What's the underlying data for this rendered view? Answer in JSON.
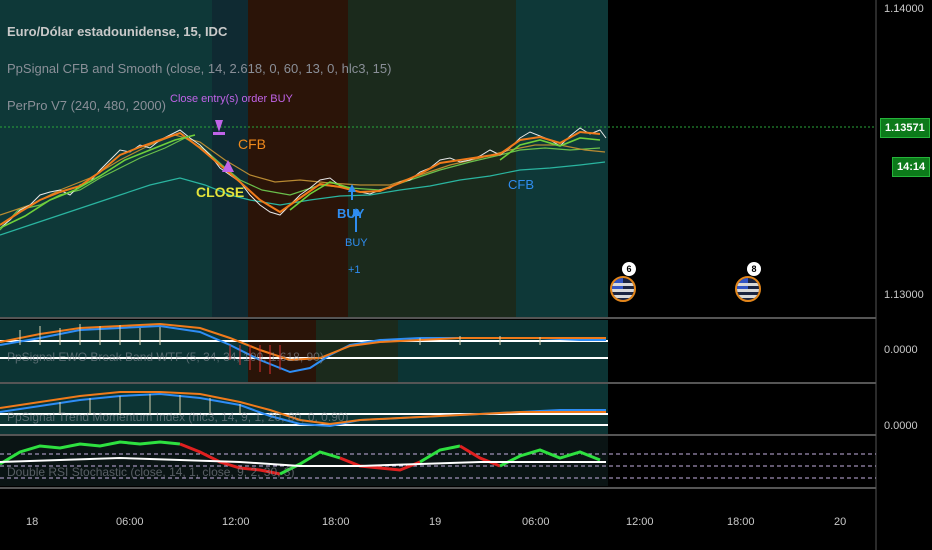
{
  "title": {
    "symbol": "Euro/Dólar estadounidense, 15, IDC",
    "indicator_1": "PpSignal CFB and Smooth (close, 14, 2.618, 0, 60, 13, 0, hlc3, 15)",
    "indicator_2": "PerPro V7 (240, 480, 2000)"
  },
  "pane_labels": {
    "ewo": "PpSignal EWO Break Band WTF (5, 34, 34, 100, 1.618, 90)",
    "second": "PpSignal Trend Momentum Index (hlc3, 14, 9, 1, 20, 80, 0, 0.90)",
    "rsi": "Double RSI Stochastic (close, 14, 1, close, 9, 2, 30, 3)"
  },
  "annotations": {
    "close_entry": "Close entry(s) order BUY",
    "cfb_1": "CFB",
    "close": "CLOSE",
    "buy_1": "BUY",
    "buy_2": "BUY",
    "buy_plus": "+1",
    "cfb_2": "CFB"
  },
  "price_axis": {
    "top": "1.14000",
    "current": "1.13571",
    "countdown": "14:14",
    "bottom": "1.13000",
    "osc_1": "0.0000",
    "osc_2": "0.0000"
  },
  "time_axis": [
    "18",
    "06:00",
    "12:00",
    "18:00",
    "19",
    "06:00",
    "12:00",
    "18:00",
    "20"
  ],
  "events": [
    {
      "icon": "us-flag-icon",
      "count": "6"
    },
    {
      "icon": "us-flag-icon",
      "count": "8"
    }
  ],
  "colors": {
    "up_trend": "#0f3a3a",
    "down_trend": "#2a1508",
    "current_price": "#0c7a1a",
    "annotation_purple": "#c063e8",
    "annotation_orange": "#f08a1c",
    "annotation_yellow": "#e3e33b",
    "annotation_blue": "#2f8df0"
  }
}
